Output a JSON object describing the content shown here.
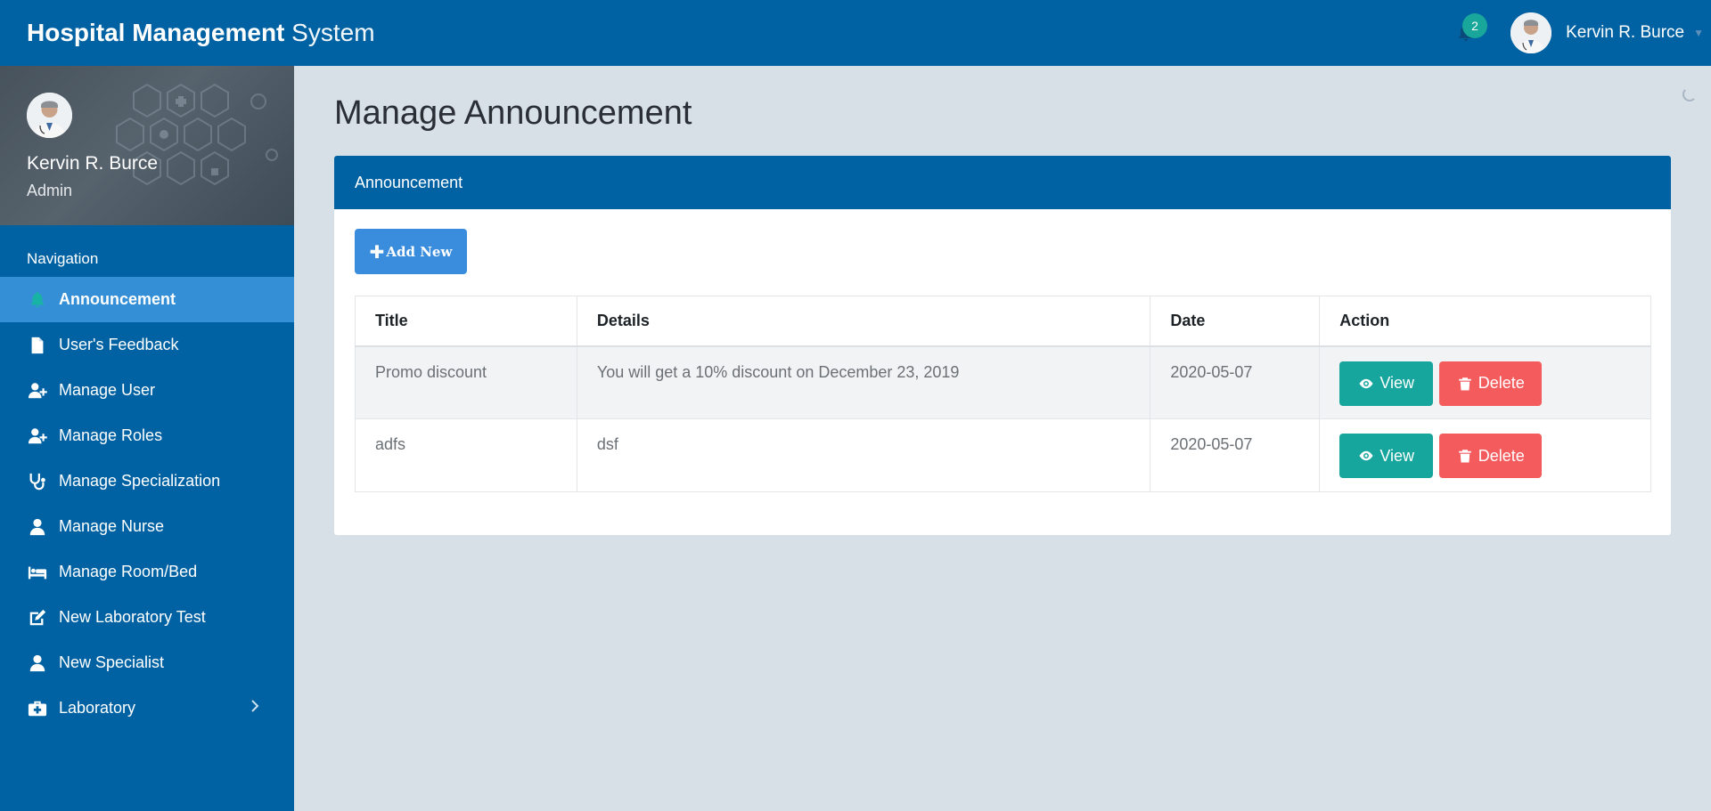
{
  "header": {
    "brand_bold": "Hospital Management",
    "brand_light": "System",
    "notification_count": "2",
    "username": "Kervin R. Burce"
  },
  "sidebar": {
    "profile_name": "Kervin R. Burce",
    "profile_role": "Admin",
    "nav_heading": "Navigation",
    "items": [
      {
        "label": "Announcement",
        "icon": "bell-icon",
        "active": true
      },
      {
        "label": "User's Feedback",
        "icon": "file-icon"
      },
      {
        "label": "Manage User",
        "icon": "user-plus-icon"
      },
      {
        "label": "Manage Roles",
        "icon": "user-plus-icon"
      },
      {
        "label": "Manage Specialization",
        "icon": "stethoscope-icon"
      },
      {
        "label": "Manage Nurse",
        "icon": "user-icon"
      },
      {
        "label": "Manage Room/Bed",
        "icon": "bed-icon"
      },
      {
        "label": "New Laboratory Test",
        "icon": "edit-icon"
      },
      {
        "label": "New Specialist",
        "icon": "user-icon"
      },
      {
        "label": "Laboratory",
        "icon": "medkit-icon",
        "has_submenu": true
      }
    ]
  },
  "main": {
    "page_title": "Manage Announcement",
    "panel_title": "Announcement",
    "add_button": "Add New",
    "table": {
      "columns": [
        "Title",
        "Details",
        "Date",
        "Action"
      ],
      "rows": [
        {
          "title": "Promo discount",
          "details": "You will get a 10% discount on December 23, 2019",
          "date": "2020-05-07"
        },
        {
          "title": "adfs",
          "details": "dsf",
          "date": "2020-05-07"
        }
      ],
      "view_label": "View",
      "delete_label": "Delete"
    }
  },
  "colors": {
    "primary": "#0062a2",
    "active_nav": "#348fd6",
    "add_button": "#3a8ddd",
    "view_button": "#17a69e",
    "delete_button": "#f35b5d",
    "badge": "#18a79a"
  }
}
